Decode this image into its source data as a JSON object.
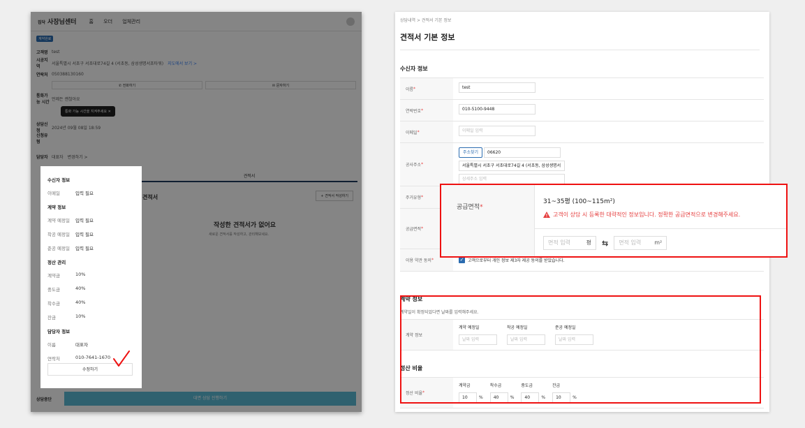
{
  "left": {
    "logo_small": "집닥",
    "logo": "사장님센터",
    "nav": [
      "홈",
      "오더",
      "업체관리"
    ],
    "badge": "계약완료",
    "rows": [
      {
        "k": "고객명",
        "v": "test"
      },
      {
        "k": "시공지역",
        "v": "서울특별시 서초구 서초대로74길 4 (서초동, 삼성생명서초타워)",
        "link": "지도에서 보기 >"
      },
      {
        "k": "연락처",
        "v": "050388130160"
      }
    ],
    "btn_call": "전화하기",
    "btn_copy": "문자하기",
    "call_time_label": "통화가능 시간",
    "call_time_value": "언제든 괜찮아요",
    "tooltip": "통화 가능 시간을 지켜주세요",
    "consult_label": "상담신청",
    "consult_value": "2024년 09월 08일 18:59",
    "type_label": "신청유형",
    "manager_label": "담당자",
    "manager_value": "대표자",
    "manager_link": "변경하기 >",
    "tab": "견적서",
    "add_btn": "+ 견적서 작성하기",
    "section_title": "견적서",
    "empty_title": "작성한 견적서가 없어요",
    "empty_sub": "새로운 견적서를 작성하고, 관리해보세요.",
    "footer_hold": "상담중단",
    "footer_go": "대면 상담 진행하기"
  },
  "popup": {
    "sec1": "수신자 정보",
    "email_k": "이메일",
    "email_v": "입력 필요",
    "sec2": "계약 정보",
    "c1_k": "계약 예정일",
    "c1_v": "입력 필요",
    "c2_k": "착공 예정일",
    "c2_v": "입력 필요",
    "c3_k": "준공 예정일",
    "c3_v": "입력 필요",
    "sec3": "정산 관리",
    "p1_k": "계약금",
    "p1_v": "10%",
    "p2_k": "중도금",
    "p2_v": "40%",
    "p3_k": "착수금",
    "p3_v": "40%",
    "p4_k": "잔금",
    "p4_v": "10%",
    "sec4": "담당자 정보",
    "m1_k": "이름",
    "m1_v": "대표자",
    "m2_k": "연락처",
    "m2_v": "010-7641-1670",
    "edit": "수정하기"
  },
  "right": {
    "crumb": "상담내역  >  견적서 기본 정보",
    "title": "견적서 기본 정보",
    "recv_title": "수신자 정보",
    "name_label": "이름",
    "name_value": "test",
    "phone_label": "연락번호",
    "phone_value": "010-5100-9448",
    "email_label": "이메일",
    "email_ph": "이메일 입력",
    "addr_label": "공사주소",
    "addr_btn": "주소찾기",
    "zip": "06620",
    "addr1": "서울특별시 서초구 서초대로74길 4 (서초동, 삼성생명서",
    "addr2_ph": "상세주소 입력",
    "house_label": "주거유형",
    "supply_label": "공급면적",
    "agree_label": "이용 약관 동의",
    "agree_text": "고객으로부터 개인 정보 제3자 제공 동의를 받았습니다.",
    "contract_title": "계약 정보",
    "contract_desc": "계약일이 확정되었다면 날짜를 입력해주세요.",
    "contract_label": "계약 정보",
    "dates": [
      {
        "t": "계약 예정일",
        "ph": "날짜 입력"
      },
      {
        "t": "착공 예정일",
        "ph": "날짜 입력"
      },
      {
        "t": "준공 예정일",
        "ph": "날짜 입력"
      }
    ],
    "settle_title": "정산 비율",
    "settle_label": "정산 비율",
    "ratios": [
      {
        "t": "계약금",
        "v": "10"
      },
      {
        "t": "착수금",
        "v": "40"
      },
      {
        "t": "중도금",
        "v": "40"
      },
      {
        "t": "잔금",
        "v": "10"
      }
    ],
    "pct": "%"
  },
  "zoom": {
    "label": "공급면적",
    "area": "31~35평 (100~115m²)",
    "warn": "고객이 상담 시 등록한 대략적인 정보입니다. 정확한 공급면적으로 변경해주세요.",
    "ph1": "면적 입력",
    "unit1": "평",
    "ph2": "면적 입력",
    "unit2": "m²",
    "swap": "⇆"
  },
  "colors": {
    "accent": "#2b6cb0",
    "error": "#e11111",
    "go": "#5bbad5"
  }
}
